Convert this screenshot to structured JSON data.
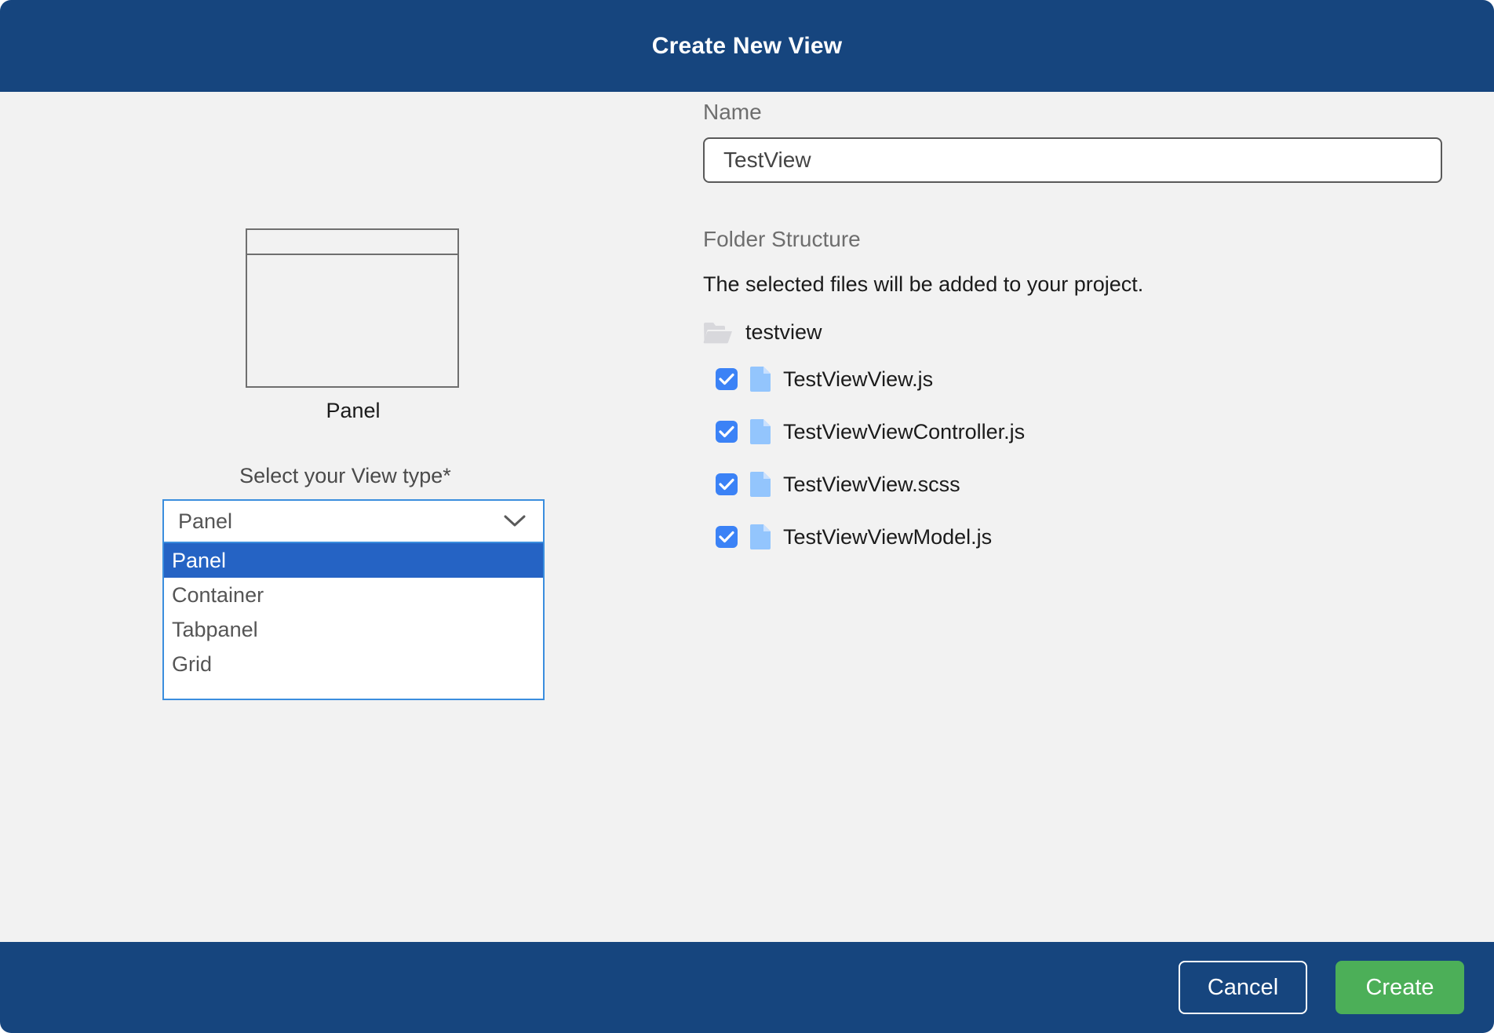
{
  "dialog": {
    "title": "Create New View",
    "header_color": "#16457e",
    "body_color": "#f2f2f2"
  },
  "preview": {
    "caption": "Panel",
    "icon": "panel-layout-icon"
  },
  "view_type": {
    "label": "Select your View type*",
    "selected": "Panel",
    "chevron_icon": "chevron-down-icon",
    "options": [
      {
        "label": "Panel",
        "selected": true
      },
      {
        "label": "Container",
        "selected": false
      },
      {
        "label": "Tabpanel",
        "selected": false
      },
      {
        "label": "Grid",
        "selected": false
      }
    ],
    "highlight_color": "#2563c4",
    "border_color": "#3b8ede"
  },
  "name_field": {
    "label": "Name",
    "value": "TestView",
    "placeholder": "Name"
  },
  "folder_structure": {
    "label": "Folder Structure",
    "description": "The selected files will be added to your project.",
    "folder": {
      "name": "testview",
      "icon": "folder-icon"
    },
    "files": [
      {
        "name": "TestViewView.js",
        "checked": true,
        "icon": "file-icon"
      },
      {
        "name": "TestViewViewController.js",
        "checked": true,
        "icon": "file-icon"
      },
      {
        "name": "TestViewView.scss",
        "checked": true,
        "icon": "file-icon"
      },
      {
        "name": "TestViewViewModel.js",
        "checked": true,
        "icon": "file-icon"
      }
    ],
    "checkbox_color": "#3b82f6",
    "file_icon_color": "#93c5fd"
  },
  "footer": {
    "cancel_label": "Cancel",
    "create_label": "Create",
    "create_color": "#4caf58"
  }
}
